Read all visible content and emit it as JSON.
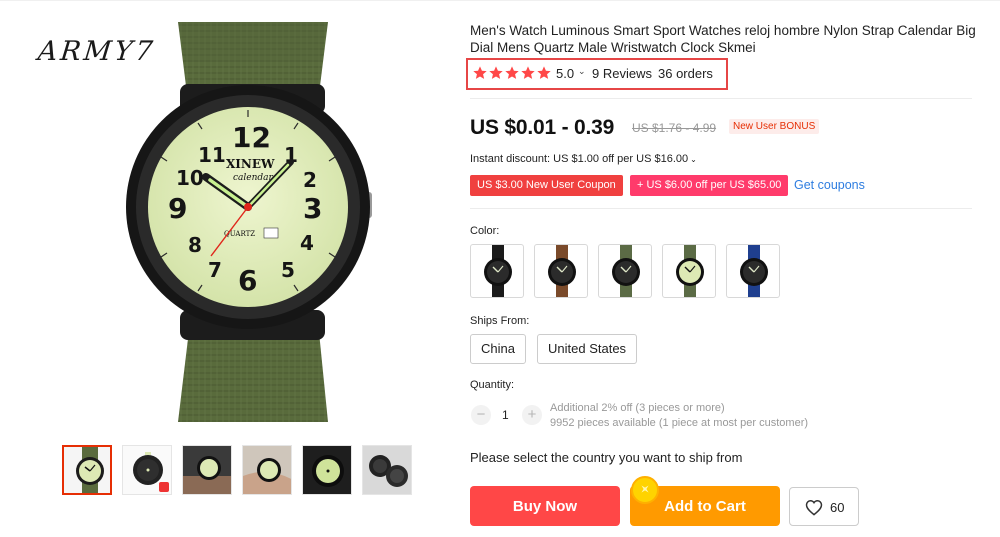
{
  "brand_mark": "ARMY7",
  "product": {
    "title": "Men's Watch Luminous Smart Sport Watches reloj hombre Nylon Strap Calendar Big Dial Mens Quartz Male Wristwatch Clock Skmei"
  },
  "rating": {
    "value": "5.0",
    "stars": 5,
    "reviews": "9 Reviews",
    "orders": "36 orders"
  },
  "price": {
    "current": "US $0.01 - 0.39",
    "original": "US $1.76 - 4.99",
    "badge": "New User BONUS"
  },
  "discount": {
    "instant": "Instant discount: US $1.00 off per US $16.00"
  },
  "coupons": [
    {
      "label": "US $3.00 New User Coupon"
    },
    {
      "label": "+ US $6.00 off per US $65.00"
    }
  ],
  "get_coupons_label": "Get coupons",
  "color": {
    "label": "Color:",
    "options": [
      {
        "name": "black",
        "strap": "#1b1b1b",
        "dial": "#2b2b2b",
        "marker": "#dfe8c8"
      },
      {
        "name": "brown",
        "strap": "#7a4a2a",
        "dial": "#2b2b2b",
        "marker": "#dfe8c8"
      },
      {
        "name": "green-dark",
        "strap": "#5b6b45",
        "dial": "#2b2b2b",
        "marker": "#dfe8c8"
      },
      {
        "name": "green-lume",
        "strap": "#5b6b45",
        "dial": "#dde9b4",
        "marker": "#111111"
      },
      {
        "name": "blue",
        "strap": "#1f3f8f",
        "dial": "#2b2b2b",
        "marker": "#dfe8c8"
      }
    ]
  },
  "ships_from": {
    "label": "Ships From:",
    "options": [
      "China",
      "United States"
    ]
  },
  "quantity": {
    "label": "Quantity:",
    "value": "1",
    "minus": "−",
    "plus": "+",
    "additional": "Additional 2% off (3 pieces or more)",
    "available": "9952 pieces available (1 piece at most per customer)"
  },
  "ship_note": "Please select the country you want to ship from",
  "actions": {
    "buy_now": "Buy Now",
    "add_to_cart": "Add to Cart",
    "wishlist_count": "60"
  },
  "colors": {
    "accent_red": "#ff4747",
    "accent_orange": "#ff9a00",
    "link_blue": "#2e7de0",
    "star": "#ff4747",
    "strap_green": "#5a6b3e",
    "dial_lume": "#dde9b4"
  },
  "icons": {
    "star": "star-icon",
    "chevron": "chevron-down-icon",
    "heart": "heart-icon",
    "coin": "coin-icon"
  }
}
